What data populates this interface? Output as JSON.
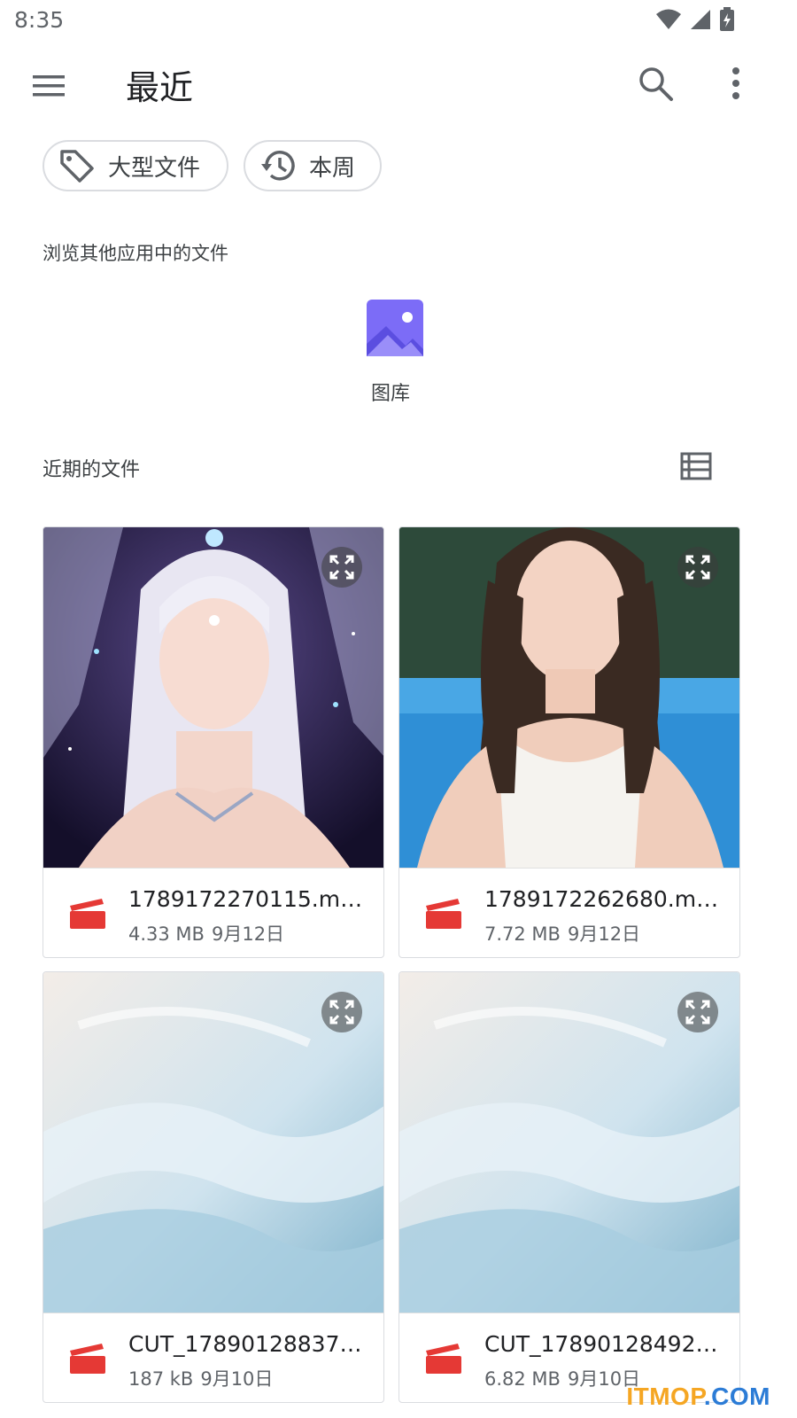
{
  "status_bar": {
    "time": "8:35",
    "icons": [
      "wifi-icon",
      "signal-icon",
      "battery-icon"
    ]
  },
  "app_bar": {
    "title": "最近",
    "icons": [
      "menu-icon",
      "search-icon",
      "more-vert-icon"
    ]
  },
  "chips": [
    {
      "label": "大型文件",
      "icon": "tag-icon"
    },
    {
      "label": "本周",
      "icon": "history-icon"
    }
  ],
  "browse_section": {
    "label": "浏览其他应用中的文件",
    "apps": [
      {
        "label": "图库",
        "icon": "gallery-icon",
        "color": "#7c6cf7"
      }
    ]
  },
  "recent_section": {
    "label": "近期的文件",
    "view_icon": "list-view-icon"
  },
  "files": [
    {
      "name": "1789172270115.m…",
      "size": "4.33 MB",
      "date": "9月12日",
      "type_icon": "video-icon",
      "thumb": "fantasy-portrait"
    },
    {
      "name": "1789172262680.m…",
      "size": "7.72 MB",
      "date": "9月12日",
      "type_icon": "video-icon",
      "thumb": "pool-portrait"
    },
    {
      "name": "CUT_17890128837…",
      "size": "187 kB",
      "date": "9月10日",
      "type_icon": "video-icon",
      "thumb": "snow-scene"
    },
    {
      "name": "CUT_17890128492…",
      "size": "6.82 MB",
      "date": "9月10日",
      "type_icon": "video-icon",
      "thumb": "snow-scene"
    }
  ],
  "watermark": {
    "text": "ITMOP",
    "dot_text": ".COM"
  },
  "colors": {
    "accent_video": "#e53935",
    "chip_border": "#dadce0",
    "gallery": "#7c6cf7"
  }
}
